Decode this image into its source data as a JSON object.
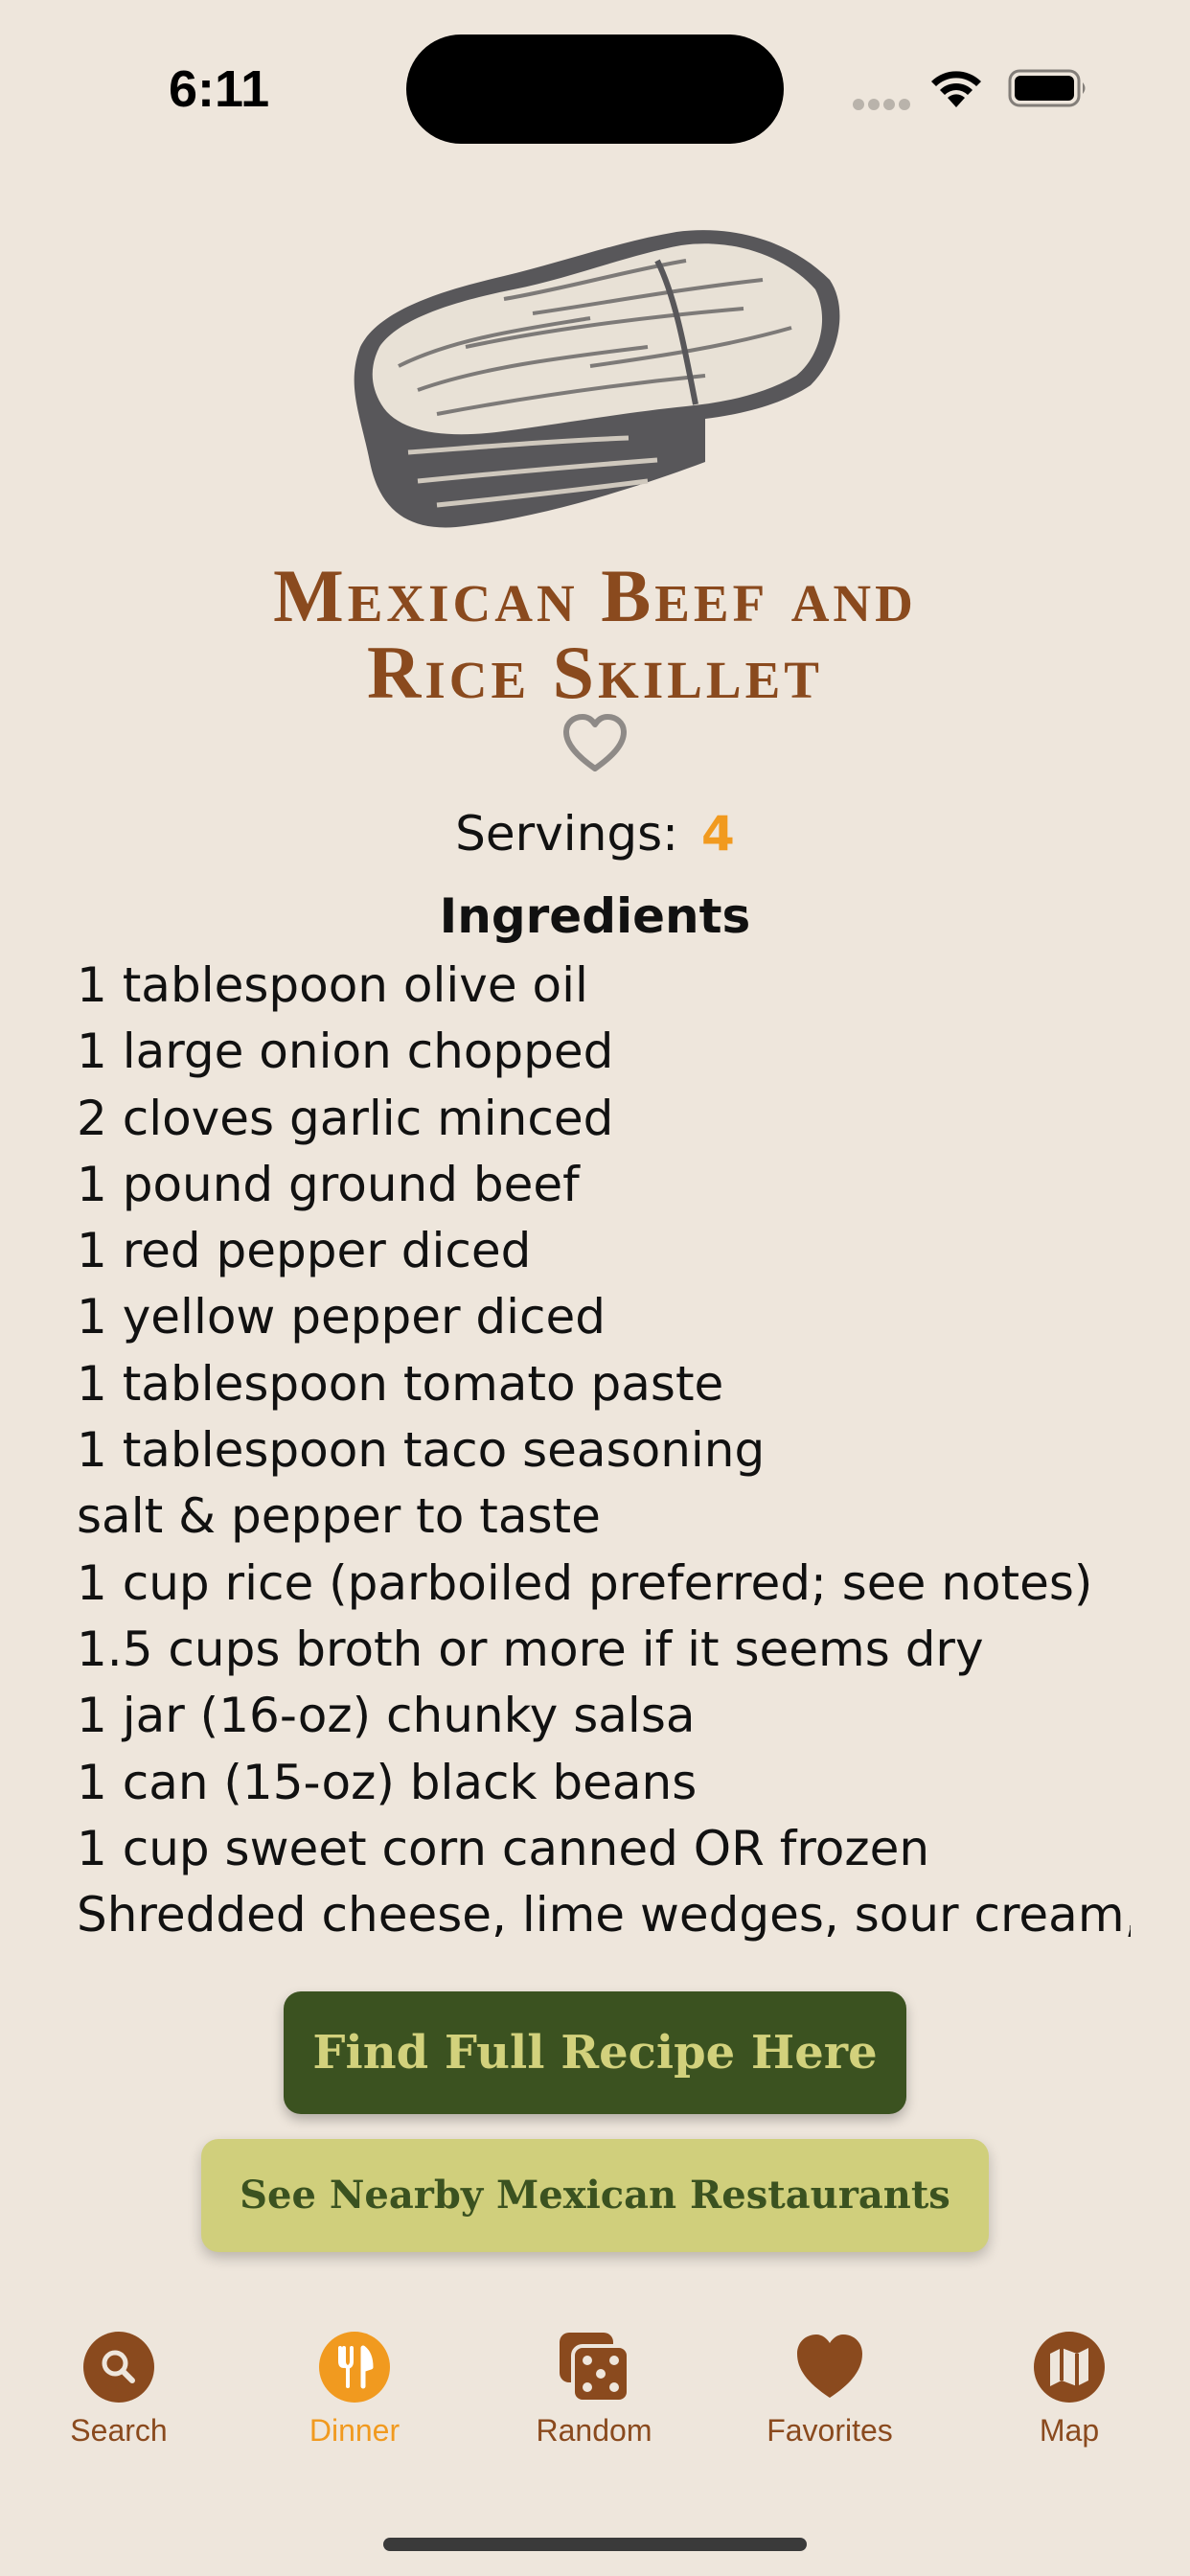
{
  "status_bar": {
    "time": "6:11"
  },
  "recipe": {
    "title_line1": "Mexican Beef and",
    "title_line2": "Rice Skillet",
    "servings_label": "Servings:",
    "servings_value": "4",
    "ingredients_heading": "Ingredients",
    "ingredients": [
      "1 tablespoon olive oil",
      "1 large onion chopped",
      "2 cloves garlic minced",
      "1 pound ground beef",
      "1 red pepper diced",
      "1 yellow pepper diced",
      "1 tablespoon tomato paste",
      "1 tablespoon taco seasoning",
      "salt & pepper to taste",
      "1 cup rice (parboiled preferred; see notes)",
      "1.5 cups broth or more if it seems dry",
      "1 jar (16-oz) chunky salsa",
      "1 can (15-oz) black beans",
      "1 cup sweet corn canned OR frozen",
      "Shredded cheese, lime wedges, sour cream,"
    ]
  },
  "buttons": {
    "full_recipe": "Find Full Recipe Here",
    "nearby": "See Nearby Mexican Restaurants"
  },
  "tabbar": {
    "active_tab": "Dinner",
    "tabs": [
      {
        "label": "Search",
        "icon": "search-icon"
      },
      {
        "label": "Dinner",
        "icon": "fork-knife-icon"
      },
      {
        "label": "Random",
        "icon": "dice-icon"
      },
      {
        "label": "Favorites",
        "icon": "heart-icon"
      },
      {
        "label": "Map",
        "icon": "map-icon"
      }
    ]
  },
  "colors": {
    "background": "#EEE6DC",
    "title_brown": "#8A4A1E",
    "accent_orange": "#F19A1F",
    "recipe_button_green": "#3B5220",
    "recipe_button_text": "#D2D17C",
    "nearby_button_bg": "#D0CF7C"
  }
}
